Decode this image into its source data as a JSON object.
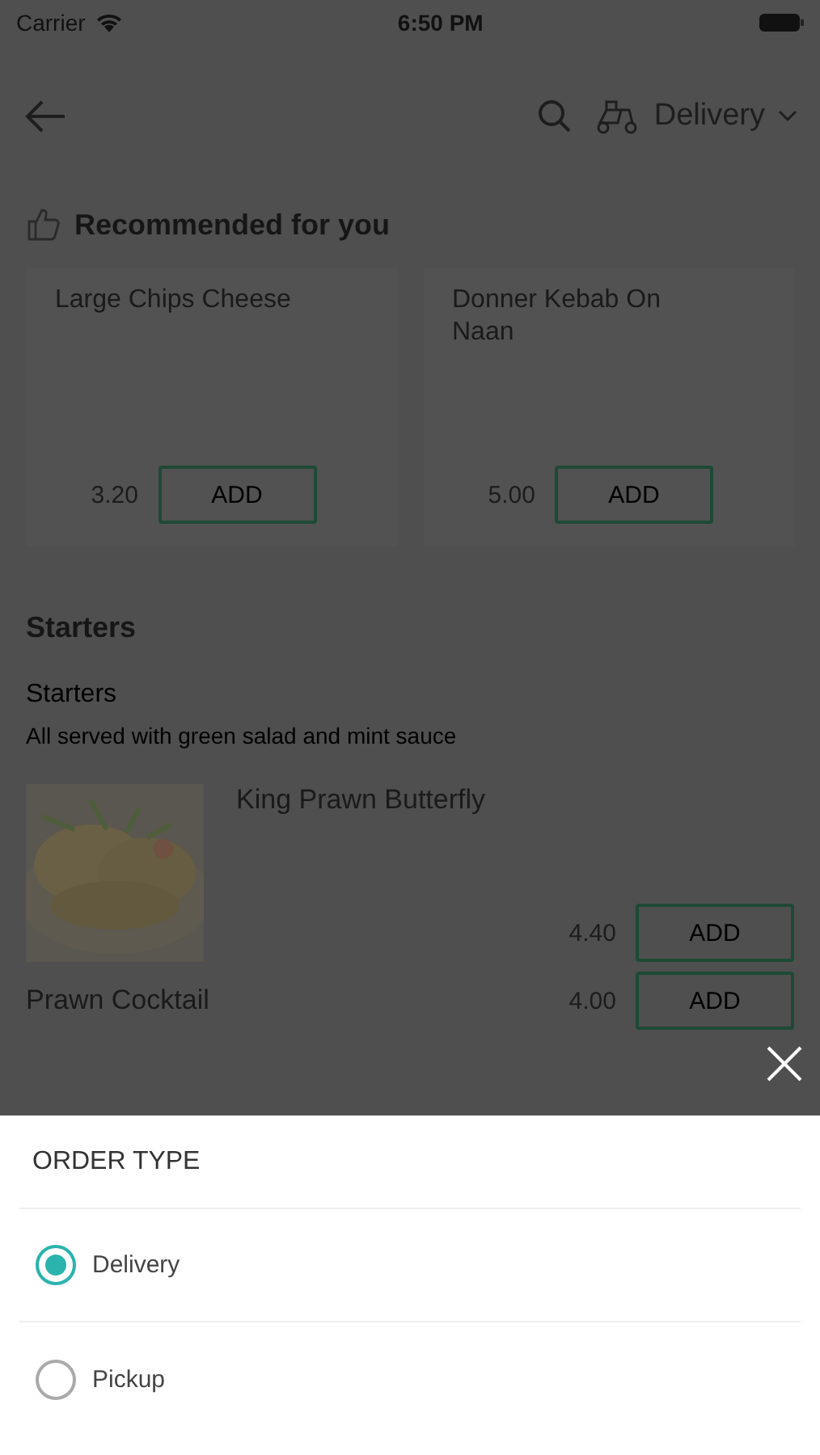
{
  "status_bar": {
    "carrier": "Carrier",
    "time": "6:50 PM"
  },
  "header": {
    "order_type": "Delivery"
  },
  "recommended": {
    "title": "Recommended for you",
    "items": [
      {
        "name": "Large Chips Cheese",
        "price": "3.20",
        "button": "ADD"
      },
      {
        "name": "Donner Kebab On Naan",
        "price": "5.00",
        "button": "ADD"
      }
    ]
  },
  "section": {
    "title": "Starters",
    "category": "Starters",
    "description": "All served with green salad and mint sauce",
    "items": [
      {
        "name": "King Prawn Butterfly",
        "price": "4.40",
        "button": "ADD"
      },
      {
        "name": "Prawn Cocktail",
        "price": "4.00",
        "button": "ADD"
      }
    ]
  },
  "sheet": {
    "title": "ORDER TYPE",
    "options": [
      {
        "label": "Delivery",
        "selected": true
      },
      {
        "label": "Pickup",
        "selected": false
      }
    ]
  }
}
